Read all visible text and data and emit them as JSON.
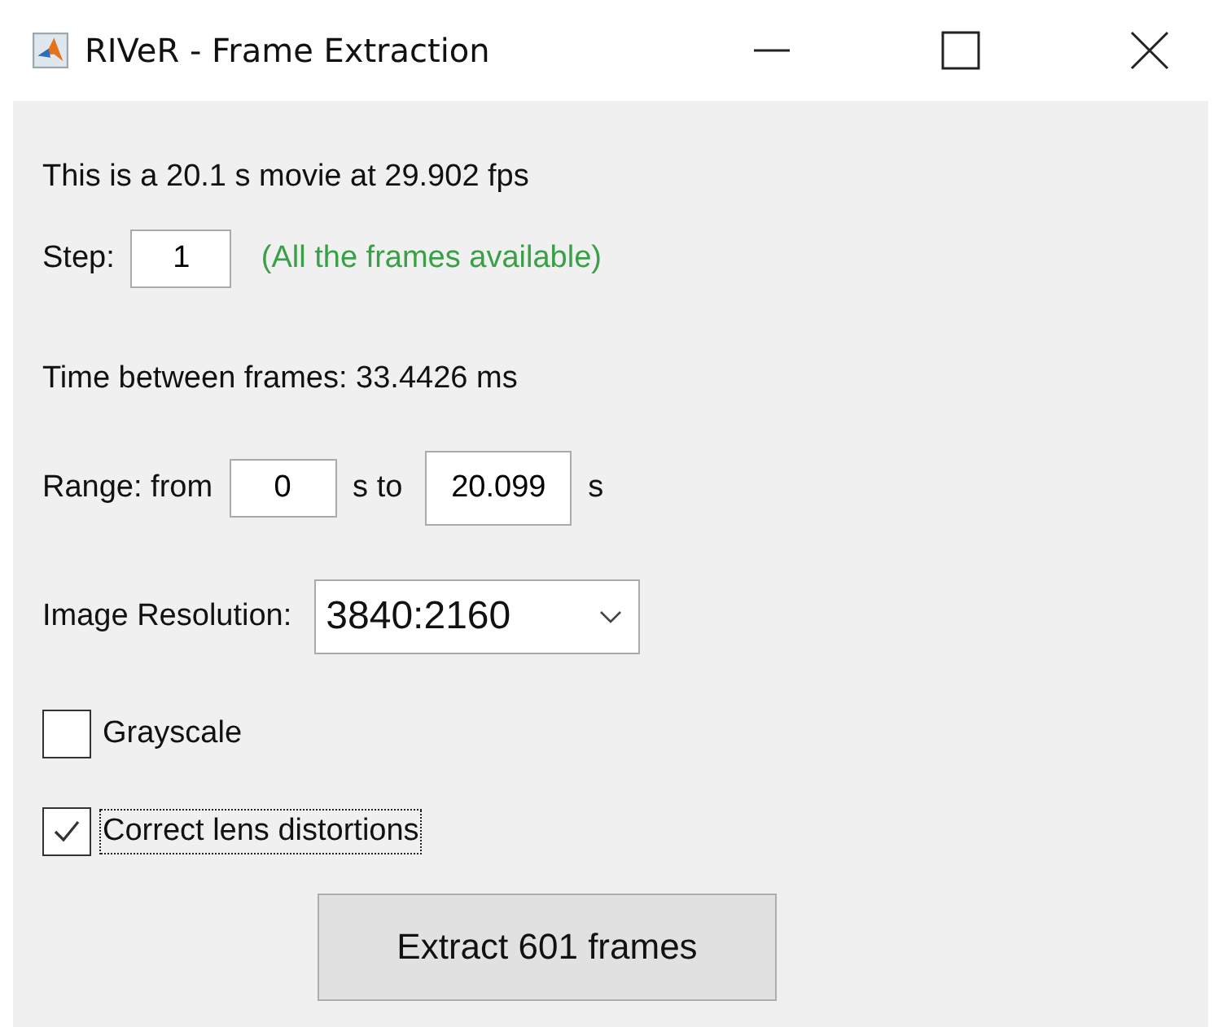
{
  "window": {
    "title": "RIVeR - Frame Extraction"
  },
  "info": "This is a 20.1 s movie at 29.902 fps",
  "step": {
    "label": "Step:",
    "value": "1",
    "note": "(All the frames available)"
  },
  "time_between": "Time between frames: 33.4426 ms",
  "range": {
    "label": "Range: from",
    "from": "0",
    "mid": "s to",
    "to": "20.099",
    "unit": "s"
  },
  "resolution": {
    "label": "Image Resolution:",
    "value": "3840:2160"
  },
  "checkboxes": [
    {
      "label": "Grayscale",
      "checked": false,
      "focused": false
    },
    {
      "label": "Correct lens distortions",
      "checked": true,
      "focused": true
    }
  ],
  "button": "Extract 601 frames"
}
